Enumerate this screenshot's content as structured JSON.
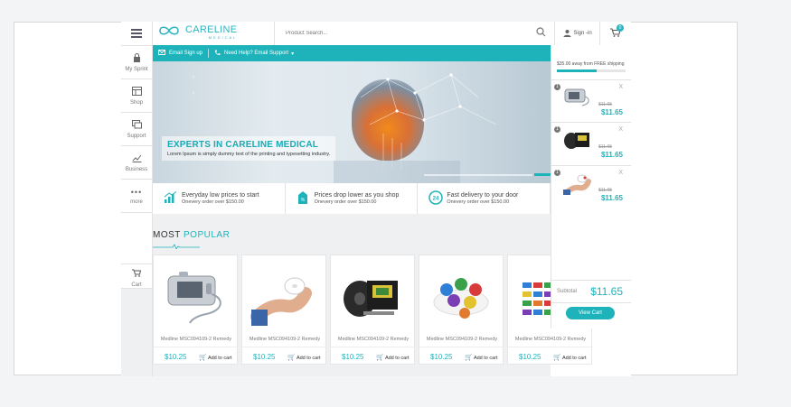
{
  "brand": {
    "name": "CARELINE",
    "tagline": "MEDICAL",
    "logo_mark": "∞"
  },
  "header": {
    "search_placeholder": "Product Search...",
    "signin_label": "Sign -in",
    "cart_count": "0"
  },
  "rail": {
    "items": [
      {
        "icon": "lock-icon",
        "glyph": "🔒",
        "label": "My Sprint"
      },
      {
        "icon": "shop-icon",
        "glyph": "▦",
        "label": "Shop"
      },
      {
        "icon": "support-icon",
        "glyph": "☐",
        "label": "Support"
      },
      {
        "icon": "business-icon",
        "glyph": "↗",
        "label": "Business"
      },
      {
        "icon": "more-icon",
        "glyph": "•••",
        "label": "more"
      }
    ],
    "cart_label": "Cart"
  },
  "topbar": {
    "email_signup": "Email Sign up",
    "help": "Need Help? Email Support"
  },
  "hero": {
    "title": "EXPERTS IN CARELINE MEDICAL",
    "subtitle": "Lorem Ipsum is simply dummy text of the printing and typesetting industry."
  },
  "features": [
    {
      "icon": "chart-icon",
      "glyph": "▟",
      "title": "Everyday low prices to start",
      "sub": "Onevery order over $150.00"
    },
    {
      "icon": "price-tag-icon",
      "glyph": "%",
      "title": "Prices drop lower as you shop",
      "sub": "Onevery order over $150.00"
    },
    {
      "icon": "delivery-24-icon",
      "glyph": "24",
      "title": "Fast delivery to your door",
      "sub": "Onevery order over $150.00"
    }
  ],
  "most_popular": {
    "title_a": "MOST",
    "title_b": "POPULAR",
    "products": [
      {
        "name": "Medline MSC094109-2 Remedy",
        "price": "$10.25",
        "add_label": "Add to cart"
      },
      {
        "name": "Medline MSC094109-2 Remedy",
        "price": "$10.25",
        "add_label": "Add to cart"
      },
      {
        "name": "Medline MSC094109-2 Remedy",
        "price": "$10.25",
        "add_label": "Add to cart"
      },
      {
        "name": "Medline MSC094109-2 Remedy",
        "price": "$10.25",
        "add_label": "Add to cart"
      },
      {
        "name": "Medline MSC094109-2 Remedy",
        "price": "$10.25",
        "add_label": "Add to cart"
      }
    ]
  },
  "cart_panel": {
    "shipping_note": "$35.00 away from FREE shipping",
    "progress": 0.58,
    "items": [
      {
        "qty": "1",
        "old_price": "$11.65",
        "price": "$11.65",
        "remove": "X"
      },
      {
        "qty": "1",
        "old_price": "$11.65",
        "price": "$11.65",
        "remove": "X"
      },
      {
        "qty": "1",
        "old_price": "$11.65",
        "price": "$11.65",
        "remove": "X"
      }
    ],
    "subtotal_label": "Subtotal",
    "subtotal_value": "$11.65",
    "view_cart": "View Cart"
  },
  "colors": {
    "accent": "#1eb3bb"
  }
}
